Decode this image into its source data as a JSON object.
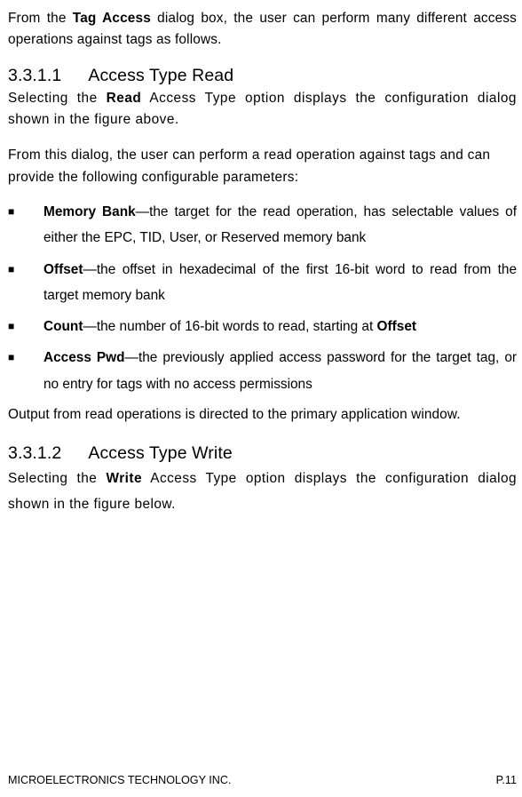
{
  "intro": {
    "prefix": "From the ",
    "bold1": "Tag Access",
    "suffix": " dialog box, the user can perform many different access operations against tags as follows."
  },
  "section1": {
    "num": "3.3.1.1",
    "title": "Access Type Read",
    "p1_prefix": "Selecting the ",
    "p1_bold": "Read",
    "p1_suffix": " Access Type option displays the configuration dialog shown in the figure above.",
    "p2": "From this dialog, the user can perform a read operation against tags and can provide the following configurable parameters:",
    "bullets": [
      {
        "bold": "Memory Bank",
        "text": "—the target for the read operation, has selectable values of either the EPC, TID, User, or Reserved memory bank"
      },
      {
        "bold": "Offset",
        "text": "—the offset in hexadecimal of the first 16-bit word to read from the target memory bank"
      },
      {
        "bold": "Count",
        "text_prefix": "—the number of 16-bit words to read, starting at ",
        "text_bold": "Offset",
        "text_suffix": ""
      },
      {
        "bold": "Access Pwd",
        "text": "—the previously applied access password for the target tag, or no entry for tags with no access permissions"
      }
    ],
    "p3": "Output from read operations is directed to the primary application window."
  },
  "section2": {
    "num": "3.3.1.2",
    "title": "Access Type Write",
    "p1_prefix": "Selecting the ",
    "p1_bold": "Write",
    "p1_suffix": " Access Type option displays the configuration dialog shown in the figure below."
  },
  "footer": {
    "left": "MICROELECTRONICS TECHNOLOGY INC.",
    "right": "P.11"
  }
}
